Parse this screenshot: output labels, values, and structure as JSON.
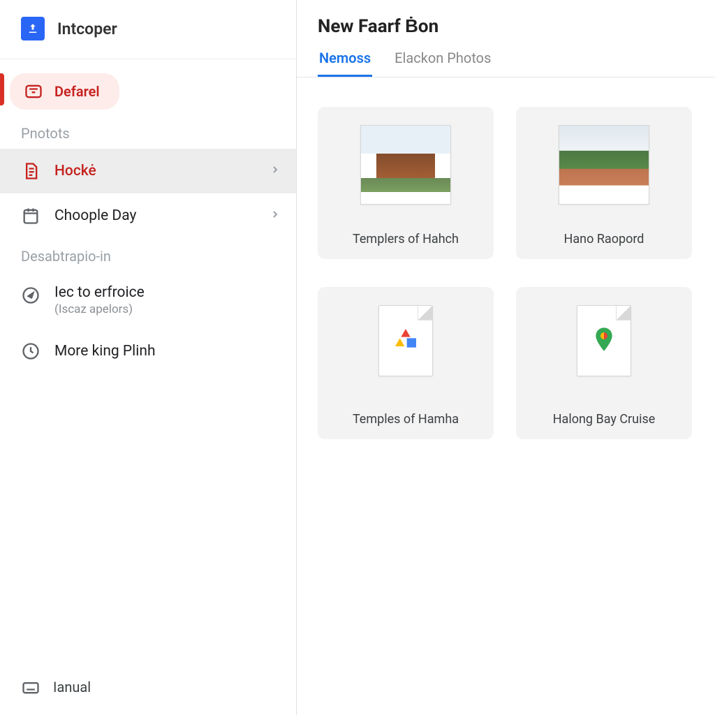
{
  "brand": {
    "title": "Intcoper"
  },
  "sidebar": {
    "primary": {
      "label": "Defarel"
    },
    "section1": {
      "label": "Pnotots"
    },
    "items": [
      {
        "label": "Hockė",
        "has_chevron": true,
        "selected": true
      },
      {
        "label": "Choople Day",
        "has_chevron": true,
        "selected": false
      }
    ],
    "section2": {
      "label": "Desabtrapio-in"
    },
    "items2": [
      {
        "label": "Iec to erfroice",
        "sub": "(Iscaz apelors)"
      },
      {
        "label": "More king Plinh"
      }
    ],
    "footer": {
      "label": "Ianual"
    }
  },
  "main": {
    "title": "New Faarf Ḃon",
    "tabs": [
      {
        "label": "Nemoss",
        "active": true
      },
      {
        "label": "Elackon Photos",
        "active": false
      }
    ],
    "cards": [
      {
        "label": "Templers of Hahch",
        "kind": "photo-temple"
      },
      {
        "label": "Hano Raopord",
        "kind": "photo-village"
      },
      {
        "label": "Temples of Hamha",
        "kind": "doc1"
      },
      {
        "label": "Halong Bay Cruise",
        "kind": "doc2"
      }
    ]
  }
}
